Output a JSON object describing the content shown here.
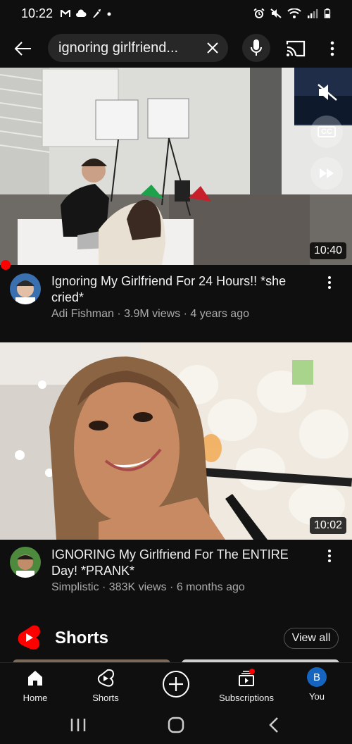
{
  "status_bar": {
    "time": "10:22",
    "left_icons": [
      "gmail-icon",
      "cloud-icon",
      "tool-icon",
      "dot-icon"
    ],
    "right_icons": [
      "alarm-icon",
      "mute-icon",
      "wifi-icon",
      "signal-icon",
      "battery-icon"
    ]
  },
  "header": {
    "search_query": "ignoring girlfriend...",
    "icons": [
      "back-arrow-icon",
      "clear-icon",
      "mic-icon",
      "cast-icon",
      "more-vert-icon"
    ]
  },
  "videos": [
    {
      "title": "Ignoring My Girlfriend For 24 Hours!! *she cried*",
      "meta": "Adi Fishman · 3.9M views · 4 years ago",
      "duration": "10:40",
      "overlay_icons": [
        "mute-icon",
        "captions-icon",
        "fast-forward-icon"
      ],
      "cc_label": "CC"
    },
    {
      "title": "IGNORING My Girlfriend For The ENTIRE Day! *PRANK*",
      "meta": "Simplistic · 383K views · 6 months ago",
      "duration": "10:02"
    }
  ],
  "shorts": {
    "title": "Shorts",
    "view_all": "View all"
  },
  "bottom_nav": {
    "home": "Home",
    "shorts": "Shorts",
    "subscriptions": "Subscriptions",
    "you": "You",
    "you_initial": "B"
  },
  "colors": {
    "background": "#0f0f0f",
    "accent_red": "#ff0000",
    "secondary_text": "#aaaaaa",
    "avatar_blue": "#1565c0"
  }
}
